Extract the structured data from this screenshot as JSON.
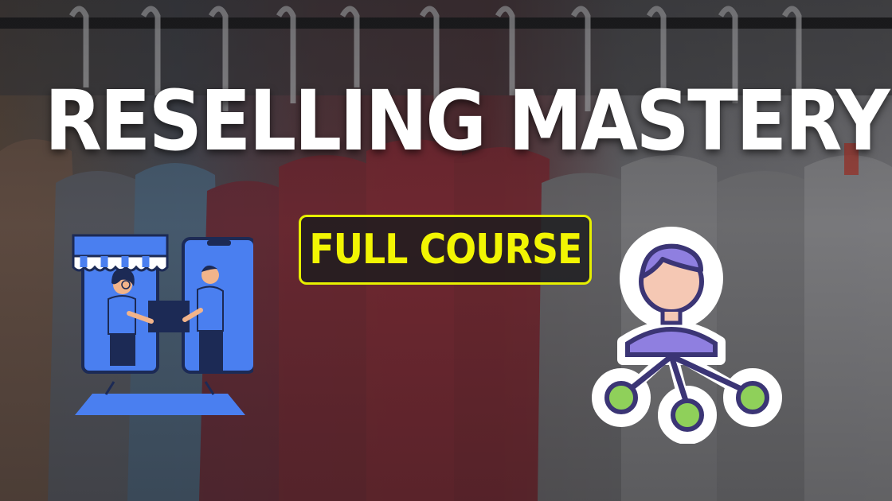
{
  "thumbnail": {
    "headline": "RESELLING MASTERY",
    "badge_label": "FULL COURSE"
  },
  "icons": {
    "left": "online-store-handshake-illustration",
    "right": "user-network-icon"
  },
  "colors": {
    "headline": "#ffffff",
    "badge_text": "#f2f503",
    "badge_border": "#e6f000",
    "illustration_blue": "#4a7ff0",
    "network_purple": "#3b3575",
    "network_node_green": "#8fd05a"
  }
}
